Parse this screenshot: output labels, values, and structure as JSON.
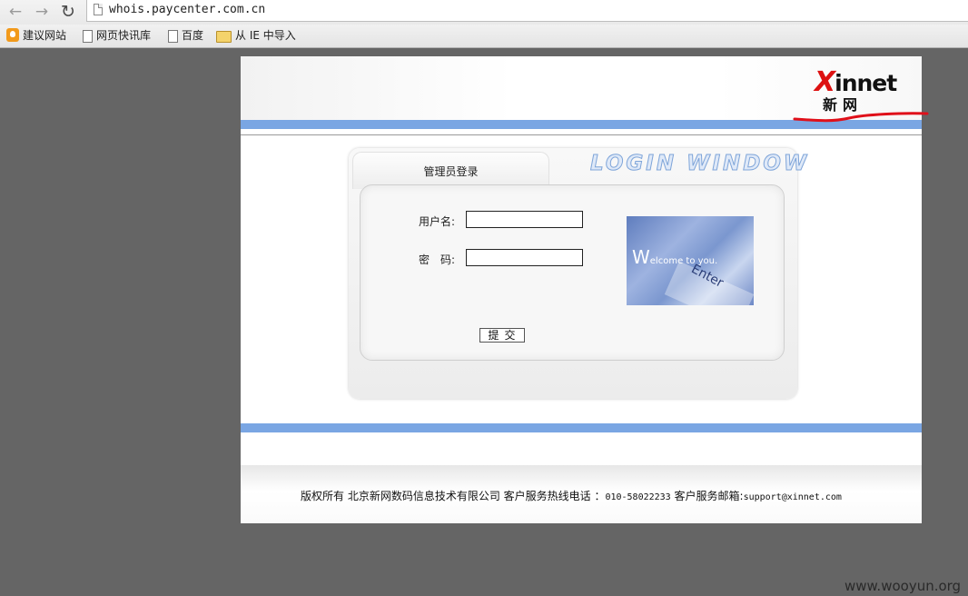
{
  "browser": {
    "url": "whois.paycenter.com.cn",
    "bookmarks": [
      {
        "label": "建议网站",
        "icon": "suggested-sites-icon"
      },
      {
        "label": "网页快讯库",
        "icon": "page-icon"
      },
      {
        "label": "百度",
        "icon": "page-icon"
      },
      {
        "label": "从 IE 中导入",
        "icon": "folder-icon"
      }
    ]
  },
  "header": {
    "logo_x": "X",
    "logo_rest": "innet",
    "logo_cn": "新网"
  },
  "login": {
    "tab_title": "管理员登录",
    "decor_title": "LOGIN WINDOW",
    "username_label": "用户名:",
    "password_label": "密　码:",
    "username_value": "",
    "password_value": "",
    "submit_label": "提交",
    "welcome_big": "W",
    "welcome_rest": "elcome to you.",
    "enter_text": "Enter"
  },
  "footer": {
    "copyright": "版权所有 北京新网数码信息技术有限公司 客户服务热线电话 ：",
    "phone": "010-58022233",
    "email_label": " 客户服务邮箱:",
    "email": "support@xinnet.com"
  },
  "watermark": "www.wooyun.org",
  "colors": {
    "accent_bar": "#7aa6e3",
    "annotation": "#e0101a",
    "background": "#656565"
  }
}
